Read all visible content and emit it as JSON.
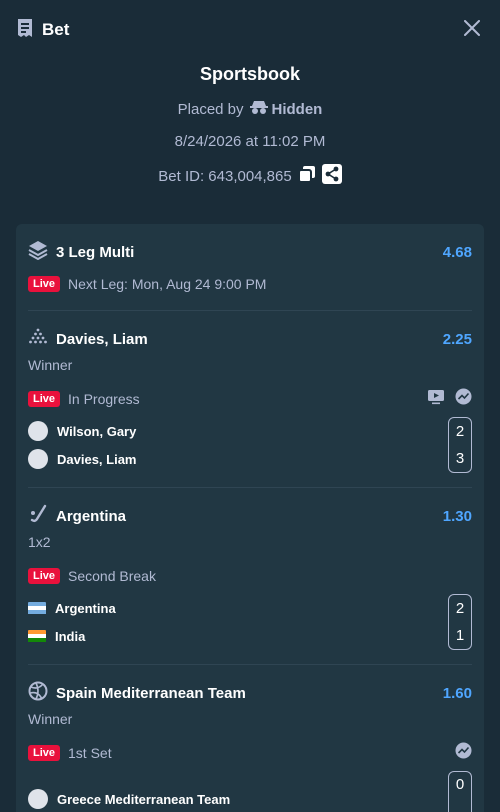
{
  "header": {
    "title": "Bet",
    "receipt_icon": "receipt-icon",
    "close_icon": "close-icon"
  },
  "summary": {
    "book": "Sportsbook",
    "placed_by_label": "Placed by",
    "user": "Hidden",
    "datetime": "8/24/2026 at 11:02 PM",
    "bet_id": "Bet ID: 643,004,865"
  },
  "multi": {
    "title": "3 Leg Multi",
    "odds": "4.68",
    "live_label": "Live",
    "next_leg": "Next Leg: Mon, Aug 24 9:00 PM"
  },
  "legs": [
    {
      "title": "Davies, Liam",
      "odds": "2.25",
      "market": "Winner",
      "live_label": "Live",
      "status": "In Progress",
      "teams": [
        {
          "name": "Wilson, Gary",
          "score": "2"
        },
        {
          "name": "Davies, Liam",
          "score": "3"
        }
      ]
    },
    {
      "title": "Argentina",
      "odds": "1.30",
      "market": "1x2",
      "live_label": "Live",
      "status": "Second Break",
      "teams": [
        {
          "name": "Argentina",
          "score": "2"
        },
        {
          "name": "India",
          "score": "1"
        }
      ]
    },
    {
      "title": "Spain Mediterranean Team",
      "odds": "1.60",
      "market": "Winner",
      "live_label": "Live",
      "status": "1st Set",
      "teams": [
        {
          "name": "Greece Mediterranean Team",
          "score": "0"
        }
      ]
    }
  ],
  "colors": {
    "background": "#1a2c38",
    "card": "#213743",
    "odds": "#4fa6ff",
    "live": "#e9113c",
    "muted": "#b1bad3"
  }
}
